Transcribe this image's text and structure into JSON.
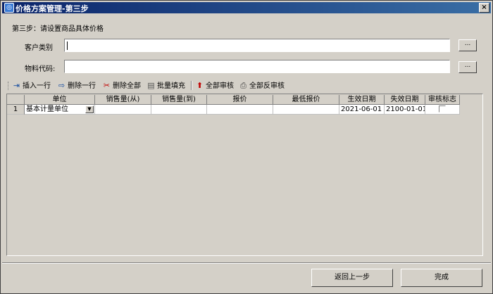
{
  "window": {
    "title": "价格方案管理-第三步",
    "close": "×"
  },
  "step_text": "第三步：请设置商品具体价格",
  "form": {
    "customer_label": "客户类别",
    "customer_value": "",
    "material_label": "物料代码:",
    "material_value": "",
    "browse_label": "..."
  },
  "toolbar": {
    "insert": "插入一行",
    "delete": "删除一行",
    "delete_all": "删除全部",
    "batch_fill": "批量填充",
    "approve_all": "全部审核",
    "unapprove_all": "全部反审核"
  },
  "table": {
    "columns": [
      "单位",
      "销售量(从)",
      "销售量(到)",
      "报价",
      "最低报价",
      "生效日期",
      "失效日期",
      "审核标志"
    ],
    "rows": [
      {
        "num": "1",
        "unit": "基本计量单位",
        "qty_from": "",
        "qty_to": "",
        "price": "",
        "min_price": "",
        "start": "2021-06-01",
        "end": "2100-01-01",
        "approved": false
      }
    ]
  },
  "buttons": {
    "back": "返回上一步",
    "finish": "完成"
  }
}
